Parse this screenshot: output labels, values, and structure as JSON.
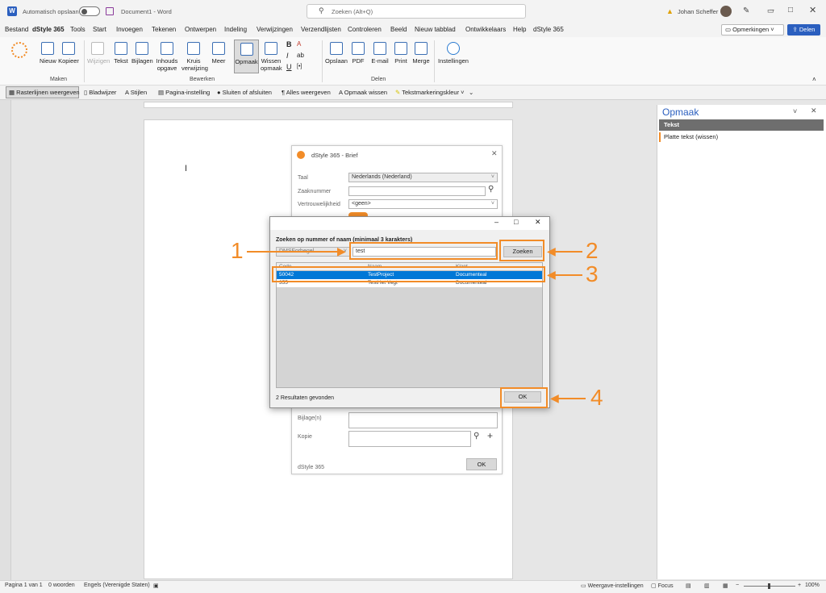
{
  "titlebar": {
    "autosave_label": "Automatisch opslaan",
    "autosave_state": "Uit",
    "doc_title": "Document1 - Word",
    "search_placeholder": "Zoeken (Alt+Q)",
    "user_name": "Johan Scheffer"
  },
  "menu": {
    "items": [
      "Bestand",
      "dStyle 365",
      "Tools",
      "Start",
      "Invoegen",
      "Tekenen",
      "Ontwerpen",
      "Indeling",
      "Verwijzingen",
      "Verzendlijsten",
      "Controleren",
      "Beeld",
      "Nieuw tabblad",
      "Ontwikkelaars",
      "Help",
      "dStyle 365"
    ],
    "comments_label": "Opmerkingen",
    "share_label": "Delen"
  },
  "ribbon": {
    "maken": [
      "Nieuw",
      "Kopieer"
    ],
    "bewerken": [
      "Wijzigen",
      "Tekst",
      "Bijlagen",
      "Inhouds opgave",
      "Kruis verwijzing",
      "Meer",
      "Opmaak",
      "Wissen opmaak"
    ],
    "delen": [
      "Opslaan",
      "PDF",
      "E-mail",
      "Print",
      "Merge"
    ],
    "instellingen": "Instellingen",
    "group_maken": "Maken",
    "group_bewerken": "Bewerken",
    "group_delen": "Delen"
  },
  "qat": [
    "Rasterlijnen weergeven",
    "Bladwijzer",
    "Stijlen",
    "Pagina-instelling",
    "Sluiten of afsluiten",
    "Alles weergeven",
    "Opmaak wissen",
    "Tekstmarkeringskleur"
  ],
  "brief": {
    "title": "dStyle 365 - Brief",
    "taal_label": "Taal",
    "taal_value": "Nederlands (Nederland)",
    "zaak_label": "Zaaknummer",
    "vertr_label": "Vertrouwelijkheid",
    "vertr_value": "<geen>",
    "bijlage_label": "Bijlage(n)",
    "kopie_label": "Kopie",
    "footer": "dStyle 365",
    "ok": "OK"
  },
  "search_dialog": {
    "heading": "Zoeken op nummer of naam (minimaal 3 karakters)",
    "source_value": "DMSForbegel",
    "query": "test",
    "search_button": "Zoeken",
    "columns": [
      "Code",
      "Naam",
      "Klant"
    ],
    "rows": [
      [
        "50042",
        "TestProject",
        "Documenteal"
      ],
      [
        "355",
        "TestHet Vegt",
        "Documenteal"
      ]
    ],
    "result_count": "2 Resultaten gevonden",
    "ok": "OK"
  },
  "pane": {
    "title": "Opmaak",
    "header": "Tekst",
    "item": "Platte tekst (wissen)"
  },
  "statusbar": {
    "page": "Pagina 1 van 1",
    "words": "0 woorden",
    "language": "Engels (Verenigde Staten)",
    "display": "Weergave-instellingen",
    "focus": "Focus",
    "zoom": "100%"
  },
  "callouts": [
    "1",
    "2",
    "3",
    "4"
  ],
  "colors": {
    "accent": "#f28c28",
    "selection": "#0078d7",
    "share": "#2b5fbf"
  }
}
